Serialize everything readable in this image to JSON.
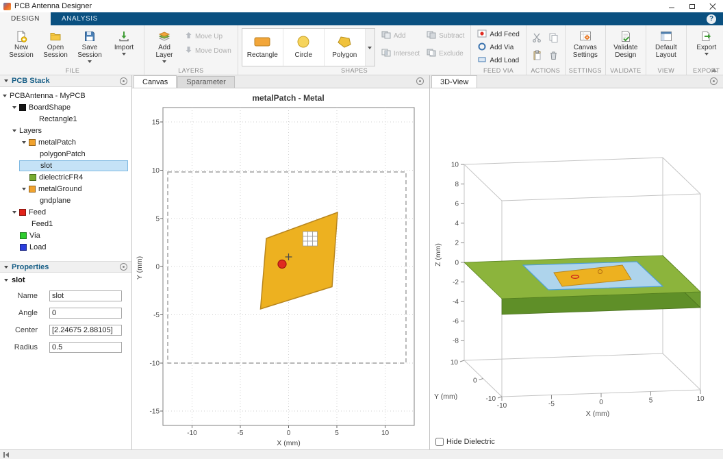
{
  "window": {
    "title": "PCB Antenna Designer"
  },
  "tabs": {
    "design": "DESIGN",
    "analysis": "ANALYSIS"
  },
  "ribbon": {
    "help_label": "?",
    "file": {
      "label": "FILE",
      "new_session": "New Session",
      "open_session": "Open Session",
      "save_session": "Save Session",
      "import": "Import"
    },
    "layers": {
      "label": "LAYERS",
      "add_layer": "Add Layer",
      "move_up": "Move Up",
      "move_down": "Move Down"
    },
    "shapes": {
      "label": "SHAPES",
      "rectangle": "Rectangle",
      "circle": "Circle",
      "polygon": "Polygon",
      "add": "Add",
      "subtract": "Subtract",
      "intersect": "Intersect",
      "exclude": "Exclude"
    },
    "feed_via": {
      "label": "FEED VIA",
      "add_feed": "Add Feed",
      "add_via": "Add Via",
      "add_load": "Add Load"
    },
    "actions": {
      "label": "ACTIONS"
    },
    "settings": {
      "label": "SETTINGS",
      "canvas_settings": "Canvas Settings"
    },
    "validate": {
      "label": "VALIDATE",
      "validate_design": "Validate Design"
    },
    "view": {
      "label": "VIEW",
      "default_layout": "Default Layout"
    },
    "export": {
      "label": "EXPORT",
      "export": "Export"
    }
  },
  "pcb_stack": {
    "title": "PCB Stack",
    "tree": [
      {
        "label": "PCBAntenna - MyPCB"
      },
      {
        "label": "BoardShape",
        "swatch": "#151515"
      },
      {
        "label": "Rectangle1"
      },
      {
        "label": "Layers"
      },
      {
        "label": "metalPatch",
        "swatch": "#F0A22E"
      },
      {
        "label": "polygonPatch"
      },
      {
        "label": "slot",
        "selected": true
      },
      {
        "label": "dielectricFR4",
        "swatch": "#77AC30"
      },
      {
        "label": "metalGround",
        "swatch": "#F0A22E"
      },
      {
        "label": "gndplane"
      },
      {
        "label": "Feed",
        "swatch": "#E2231A"
      },
      {
        "label": "Feed1"
      },
      {
        "label": "Via",
        "swatch": "#2ECC2E"
      },
      {
        "label": "Load",
        "swatch": "#2B3EDD"
      }
    ]
  },
  "properties": {
    "title": "Properties",
    "selected_shape": "slot",
    "fields": [
      {
        "label": "Name",
        "value": "slot"
      },
      {
        "label": "Angle",
        "value": "0"
      },
      {
        "label": "Center",
        "value": "[2.24675 2.88105]"
      },
      {
        "label": "Radius",
        "value": "0.5"
      }
    ]
  },
  "canvas": {
    "tab_canvas": "Canvas",
    "tab_sparameter": "Sparameter",
    "plot_title": "metalPatch - Metal",
    "xlabel": "X (mm)",
    "ylabel": "Y (mm)",
    "x_ticks": [
      "-10",
      "-5",
      "0",
      "5",
      "10"
    ],
    "y_ticks": [
      "15",
      "10",
      "5",
      "0",
      "-5",
      "-10",
      "-15"
    ]
  },
  "view3d": {
    "tab": "3D-View",
    "xlabel": "X (mm)",
    "ylabel": "Y (mm)",
    "zlabel": "Z (mm)",
    "x_ticks": [
      "-10",
      "-5",
      "0",
      "5",
      "10"
    ],
    "y_ticks": [
      "10",
      "0",
      "-10"
    ],
    "z_ticks": [
      "10",
      "8",
      "6",
      "4",
      "2",
      "0",
      "-2",
      "-4",
      "-6",
      "-8"
    ],
    "hide_dielectric": "Hide Dielectric"
  },
  "colors": {
    "patch_orange": "#EDB120",
    "dielectric_green": "#77AC30",
    "feed_red": "#E02B20",
    "via_green": "#2ECC2E",
    "load_blue": "#2B3EDD",
    "selection_blue": "#7FB9E2",
    "toolstrip_blue": "#0A5080"
  }
}
